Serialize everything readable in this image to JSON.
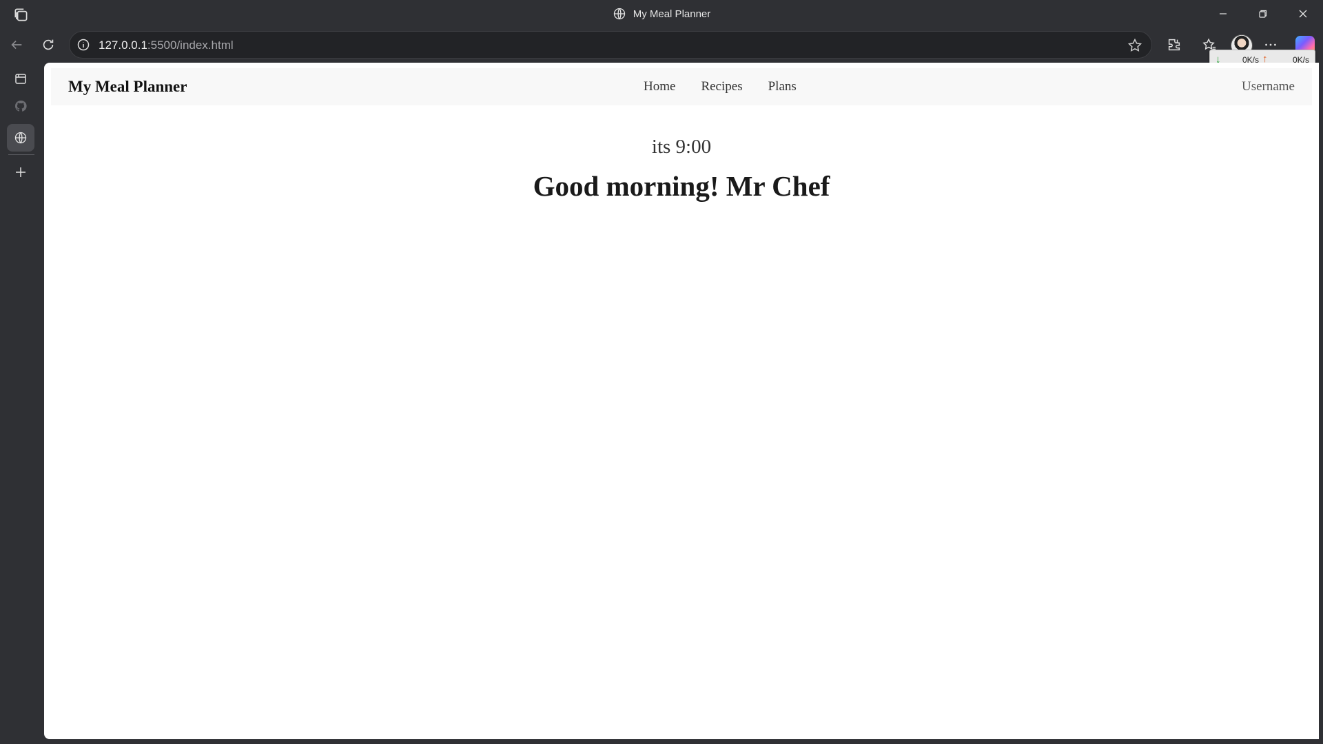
{
  "browser": {
    "window_title": "My Meal Planner",
    "address": {
      "host": "127.0.0.1",
      "path": ":5500/index.html"
    },
    "net_speed": {
      "download": "0K/s",
      "upload": "0K/s"
    }
  },
  "navbar": {
    "brand": "My Meal Planner",
    "links": [
      {
        "label": "Home"
      },
      {
        "label": "Recipes"
      },
      {
        "label": "Plans"
      }
    ],
    "username": "Username"
  },
  "hero": {
    "time_text": "its 9:00",
    "greeting": "Good morning! Mr Chef"
  },
  "icons": {
    "titlebar": [
      "tab-actions-icon",
      "globe-icon",
      "minimize-icon",
      "restore-icon",
      "close-icon"
    ],
    "toolbar": [
      "back-icon",
      "refresh-icon",
      "info-icon",
      "favorite-star-icon",
      "extensions-icon",
      "favorites-icon",
      "profile-avatar",
      "more-icon",
      "copilot-icon"
    ],
    "sidebar": [
      "tab-icon",
      "github-icon",
      "globe-icon",
      "add-icon"
    ]
  },
  "colors": {
    "chrome": "#2f3034",
    "page_bg": "#ffffff",
    "navbar_bg": "#f8f8f8"
  }
}
